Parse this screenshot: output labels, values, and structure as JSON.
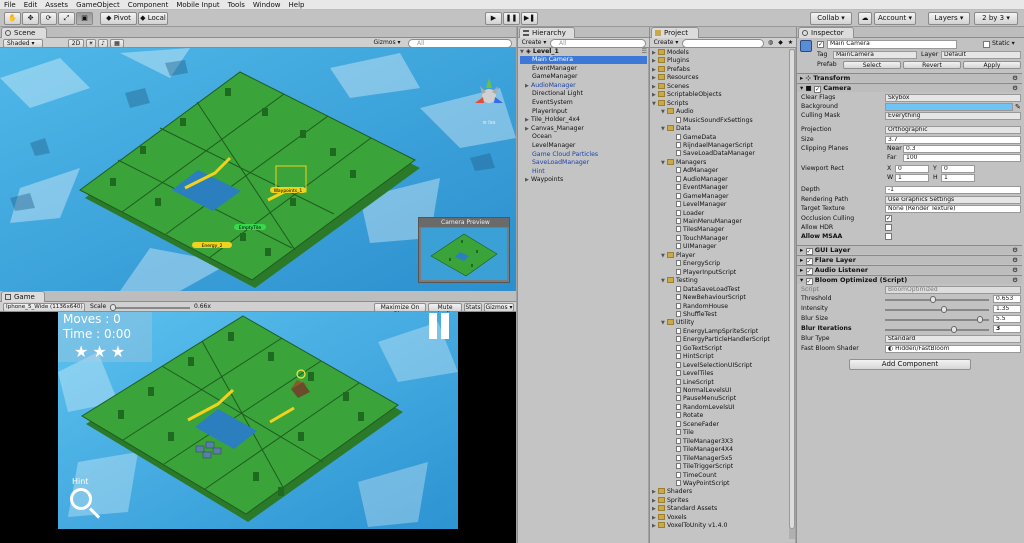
{
  "menu": [
    "File",
    "Edit",
    "Assets",
    "GameObject",
    "Component",
    "Mobile Input",
    "Tools",
    "Window",
    "Help"
  ],
  "toolbar": {
    "pivot": "Pivot",
    "local": "Local",
    "collab": "Collab ▾",
    "account": "Account ▾",
    "layers": "Layers",
    "layout": "2 by 3"
  },
  "scene": {
    "tab": "Scene",
    "shaded": "Shaded",
    "mode2d": "2D",
    "gizmos": "Gizmos ▾",
    "search": "All",
    "iso": "≡ Iso",
    "camera_preview": "Camera Preview",
    "waypoints_label": "Waypoints_1",
    "energy_label": "Energy_2",
    "empty_label": "EmptyTile"
  },
  "game": {
    "tab": "Game",
    "resolution": "Iphone_5_Wide (1136x640)",
    "scale_label": "Scale",
    "scale_value": "0.66x",
    "maximize": "Maximize On Play",
    "mute": "Mute Audio",
    "stats": "Stats",
    "gizmos": "Gizmos ▾",
    "moves": "Moves : 0",
    "time": "Time : 0:00",
    "hint": "Hint",
    "stars": 3
  },
  "hierarchy": {
    "tab": "Hierarchy",
    "create": "Create ▾",
    "search": "All",
    "scene": "Level_1",
    "items": [
      "Main Camera",
      "EventManager",
      "GameManager",
      "AudioManager",
      "Directional Light",
      "EventSystem",
      "PlayerInput",
      "Tile_Holder_4x4",
      "Canvas_Manager",
      "Ocean",
      "LevelManager",
      "Game Cloud Particles",
      "SaveLoadManager",
      "Hint",
      "Waypoints"
    ]
  },
  "project": {
    "tab": "Project",
    "create": "Create ▾",
    "search": "",
    "lines": [
      {
        "t": "Models",
        "l": 0,
        "f": true
      },
      {
        "t": "Plugins",
        "l": 0,
        "f": true
      },
      {
        "t": "Prefabs",
        "l": 0,
        "f": true
      },
      {
        "t": "Resources",
        "l": 0,
        "f": true
      },
      {
        "t": "Scenes",
        "l": 0,
        "f": true
      },
      {
        "t": "ScriptableObjects",
        "l": 0,
        "f": true
      },
      {
        "t": "Scripts",
        "l": 0,
        "f": true
      },
      {
        "t": "Audio",
        "l": 1,
        "f": true
      },
      {
        "t": "MusicSoundFxSettings",
        "l": 2,
        "f": false
      },
      {
        "t": "Data",
        "l": 1,
        "f": true
      },
      {
        "t": "GameData",
        "l": 2,
        "f": false
      },
      {
        "t": "RijndaelManagerScript",
        "l": 2,
        "f": false
      },
      {
        "t": "SaveLoadDataManager",
        "l": 2,
        "f": false
      },
      {
        "t": "Managers",
        "l": 1,
        "f": true
      },
      {
        "t": "AdManager",
        "l": 2,
        "f": false
      },
      {
        "t": "AudioManager",
        "l": 2,
        "f": false
      },
      {
        "t": "EventManager",
        "l": 2,
        "f": false
      },
      {
        "t": "GameManager",
        "l": 2,
        "f": false
      },
      {
        "t": "LevelManager",
        "l": 2,
        "f": false
      },
      {
        "t": "Loader",
        "l": 2,
        "f": false
      },
      {
        "t": "MainMenuManager",
        "l": 2,
        "f": false
      },
      {
        "t": "TilesManager",
        "l": 2,
        "f": false
      },
      {
        "t": "TouchManager",
        "l": 2,
        "f": false
      },
      {
        "t": "UIManager",
        "l": 2,
        "f": false
      },
      {
        "t": "Player",
        "l": 1,
        "f": true
      },
      {
        "t": "EnergyScrip",
        "l": 2,
        "f": false
      },
      {
        "t": "PlayerInputScript",
        "l": 2,
        "f": false
      },
      {
        "t": "Testing",
        "l": 1,
        "f": true
      },
      {
        "t": "DataSaveLoadTest",
        "l": 2,
        "f": false
      },
      {
        "t": "NewBehaviourScript",
        "l": 2,
        "f": false
      },
      {
        "t": "RandomHouse",
        "l": 2,
        "f": false
      },
      {
        "t": "ShuffleTest",
        "l": 2,
        "f": false
      },
      {
        "t": "Utility",
        "l": 1,
        "f": true
      },
      {
        "t": "EnergyLampSpriteScript",
        "l": 2,
        "f": false
      },
      {
        "t": "EnergyParticleHandlerScript",
        "l": 2,
        "f": false
      },
      {
        "t": "GoTextScript",
        "l": 2,
        "f": false
      },
      {
        "t": "HintScript",
        "l": 2,
        "f": false
      },
      {
        "t": "LevelSelectionUIScript",
        "l": 2,
        "f": false
      },
      {
        "t": "LevelTiles",
        "l": 2,
        "f": false
      },
      {
        "t": "LineScript",
        "l": 2,
        "f": false
      },
      {
        "t": "NormalLevelsUI",
        "l": 2,
        "f": false
      },
      {
        "t": "PauseMenuScript",
        "l": 2,
        "f": false
      },
      {
        "t": "RandomLevelsUI",
        "l": 2,
        "f": false
      },
      {
        "t": "Rotate",
        "l": 2,
        "f": false
      },
      {
        "t": "SceneFader",
        "l": 2,
        "f": false
      },
      {
        "t": "Tile",
        "l": 2,
        "f": false
      },
      {
        "t": "TileManager3X3",
        "l": 2,
        "f": false
      },
      {
        "t": "TileManager4X4",
        "l": 2,
        "f": false
      },
      {
        "t": "TileManager5x5",
        "l": 2,
        "f": false
      },
      {
        "t": "TileTriggerScript",
        "l": 2,
        "f": false
      },
      {
        "t": "TimeCount",
        "l": 2,
        "f": false
      },
      {
        "t": "WayPointScript",
        "l": 2,
        "f": false
      },
      {
        "t": "Shaders",
        "l": 0,
        "f": true
      },
      {
        "t": "Sprites",
        "l": 0,
        "f": true
      },
      {
        "t": "Standard Assets",
        "l": 0,
        "f": true
      },
      {
        "t": "Voxels",
        "l": 0,
        "f": true
      },
      {
        "t": "VoxelToUnity v1.4.0",
        "l": 0,
        "f": true
      }
    ]
  },
  "inspector": {
    "tab": "Inspector",
    "name": "Main Camera",
    "static": "Static ▾",
    "tag_label": "Tag",
    "tag": "MainCamera",
    "layer_label": "Layer",
    "layer": "Default",
    "prefab_label": "Prefab",
    "select": "Select",
    "revert": "Revert",
    "apply": "Apply",
    "transform": "Transform",
    "camera": "Camera",
    "camera_fields": {
      "clear_flags": "Clear Flags",
      "clear_flags_v": "Skybox",
      "background": "Background",
      "culling": "Culling Mask",
      "culling_v": "Everything",
      "projection": "Projection",
      "projection_v": "Orthographic",
      "size": "Size",
      "size_v": "3.7",
      "clipping": "Clipping Planes",
      "near": "Near",
      "near_v": "0.3",
      "far": "Far",
      "far_v": "100",
      "viewport": "Viewport Rect",
      "vx": "X",
      "vx_v": "0",
      "vy": "Y",
      "vy_v": "0",
      "vw": "W",
      "vw_v": "1",
      "vh": "H",
      "vh_v": "1",
      "depth": "Depth",
      "depth_v": "-1",
      "rpath": "Rendering Path",
      "rpath_v": "Use Graphics Settings",
      "target": "Target Texture",
      "target_v": "None (Render Texture)",
      "occlusion": "Occlusion Culling",
      "hdr": "Allow HDR",
      "msaa": "Allow MSAA"
    },
    "gui_layer": "GUI Layer",
    "flare_layer": "Flare Layer",
    "audio_listener": "Audio Listener",
    "bloom": "Bloom Optimized (Script)",
    "bloom_fields": {
      "script": "Script",
      "script_v": "BloomOptimized",
      "threshold": "Threshold",
      "threshold_v": "0.653",
      "intensity": "Intensity",
      "intensity_v": "1.35",
      "blur_size": "Blur Size",
      "blur_size_v": "5.5",
      "blur_iter": "Blur Iterations",
      "blur_iter_v": "3",
      "blur_type": "Blur Type",
      "blur_type_v": "Standard",
      "shader": "Fast Bloom Shader",
      "shader_v": "Hidden/FastBloom"
    },
    "add_component": "Add Component"
  },
  "colors": {
    "accent": "#3c78d8",
    "grass": "#3aa33a",
    "water": "#39a0d6",
    "background_swatch": "#6fc3f5"
  }
}
